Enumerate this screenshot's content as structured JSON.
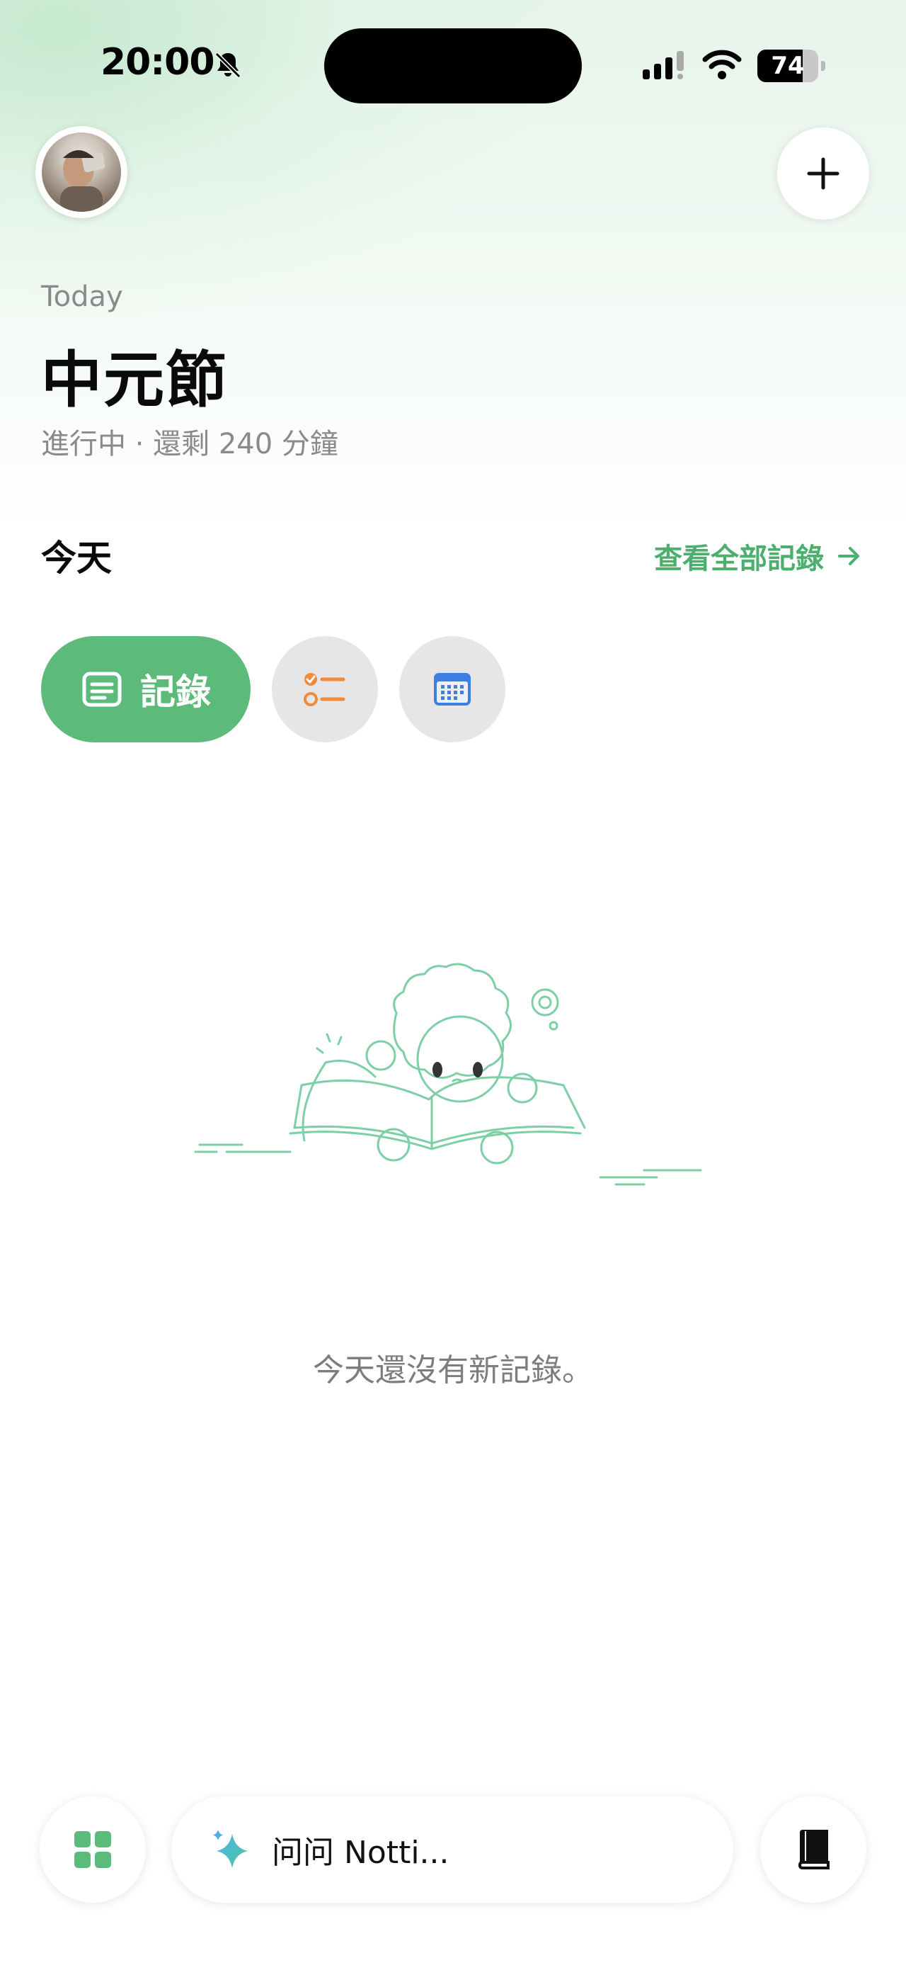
{
  "status_bar": {
    "time": "20:00",
    "battery_percent": "74",
    "battery_level": 0.74,
    "icons": [
      "bell-slash-icon",
      "cellular-signal-icon",
      "wifi-icon",
      "battery-icon"
    ]
  },
  "header": {
    "avatar_icon": "user-avatar",
    "add_icon": "plus-icon"
  },
  "event": {
    "day_label": "Today",
    "title": "中元節",
    "status": "進行中 · 還剩 240 分鐘"
  },
  "section": {
    "title": "今天",
    "view_all_label": "查看全部記錄",
    "view_all_icon": "arrow-right-icon"
  },
  "filters": [
    {
      "label": "記錄",
      "icon": "note-icon",
      "active": true
    },
    {
      "label": "",
      "icon": "checklist-icon",
      "active": false
    },
    {
      "label": "",
      "icon": "calendar-icon",
      "active": false
    }
  ],
  "empty_state": {
    "illustration": "robot-reading-book",
    "message": "今天還沒有新記錄。"
  },
  "bottom_bar": {
    "apps_icon": "grid-apps-icon",
    "ask_placeholder": "问问 Notti...",
    "ask_icon": "sparkle-icon",
    "library_icon": "book-icon"
  },
  "colors": {
    "accent_green": "#5cbb7a",
    "link_green": "#4caf6e",
    "task_orange": "#f08a3c",
    "calendar_blue": "#3d7fe0",
    "illustration_stroke": "#7dcfa6"
  }
}
